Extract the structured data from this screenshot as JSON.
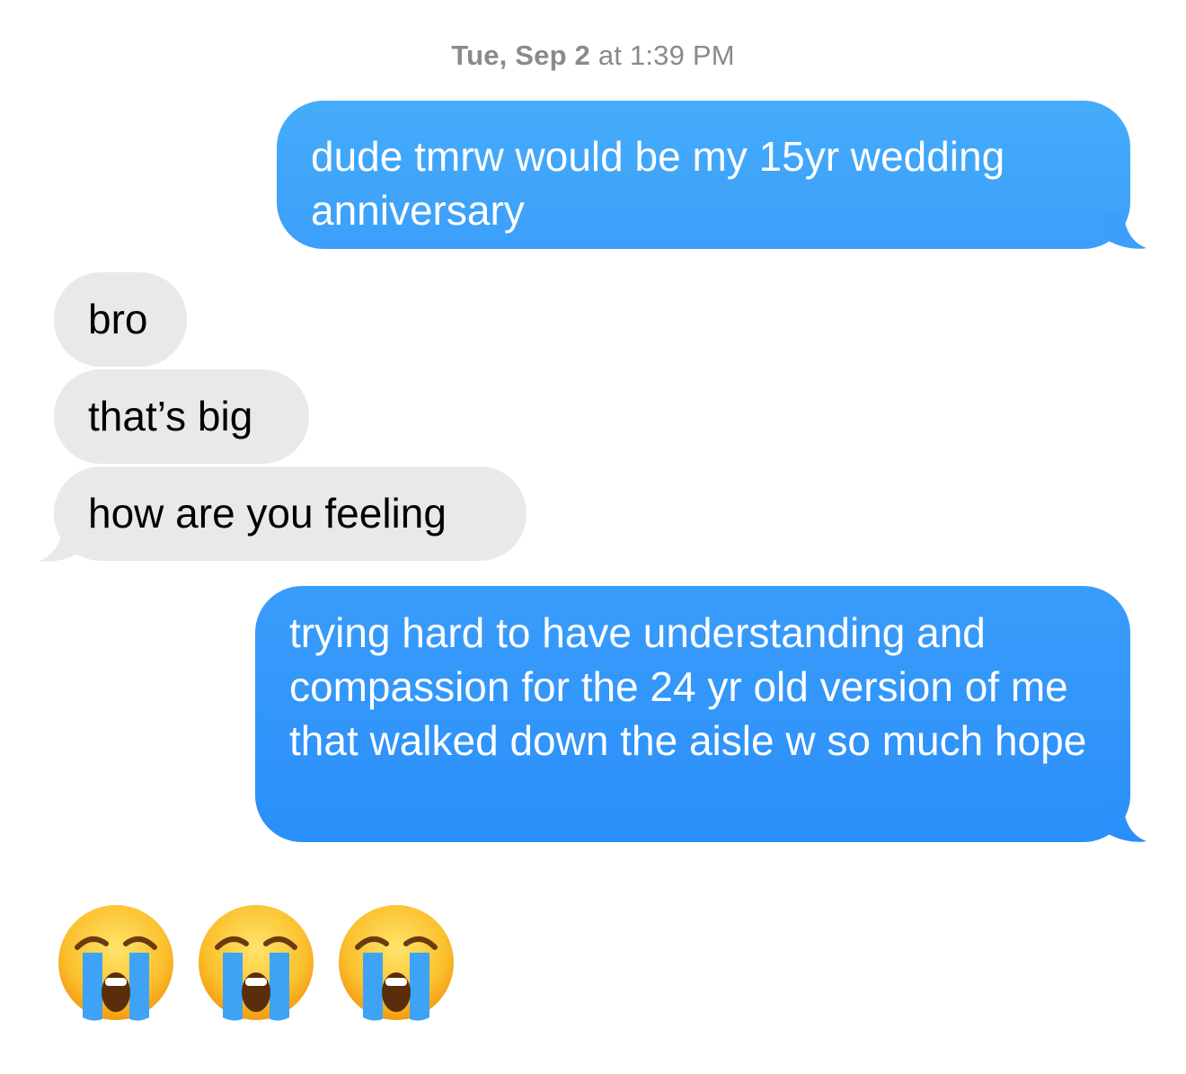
{
  "timestamp": {
    "day": "Tue, Sep 2",
    "connector": "at",
    "time": "1:39 PM"
  },
  "messages": [
    {
      "direction": "outgoing",
      "text": "dude tmrw would be my 15yr wedding anniversary"
    },
    {
      "direction": "incoming",
      "text": "bro"
    },
    {
      "direction": "incoming",
      "text": "that’s big"
    },
    {
      "direction": "incoming",
      "text": "how are you feeling"
    },
    {
      "direction": "outgoing",
      "text": "trying hard to have understanding and compassion for the 24 yr old version of me that walked down the aisle w so much hope"
    }
  ],
  "emoji_message": {
    "emojis": [
      "loudly-crying-face",
      "loudly-crying-face",
      "loudly-crying-face"
    ]
  },
  "colors": {
    "outgoing_bubble": "#3c9ffa",
    "incoming_bubble": "#e9e9eb",
    "timestamp_text": "#8a8a8e",
    "emoji_face": "#fbc02d",
    "emoji_tears": "#3fa3f5"
  }
}
